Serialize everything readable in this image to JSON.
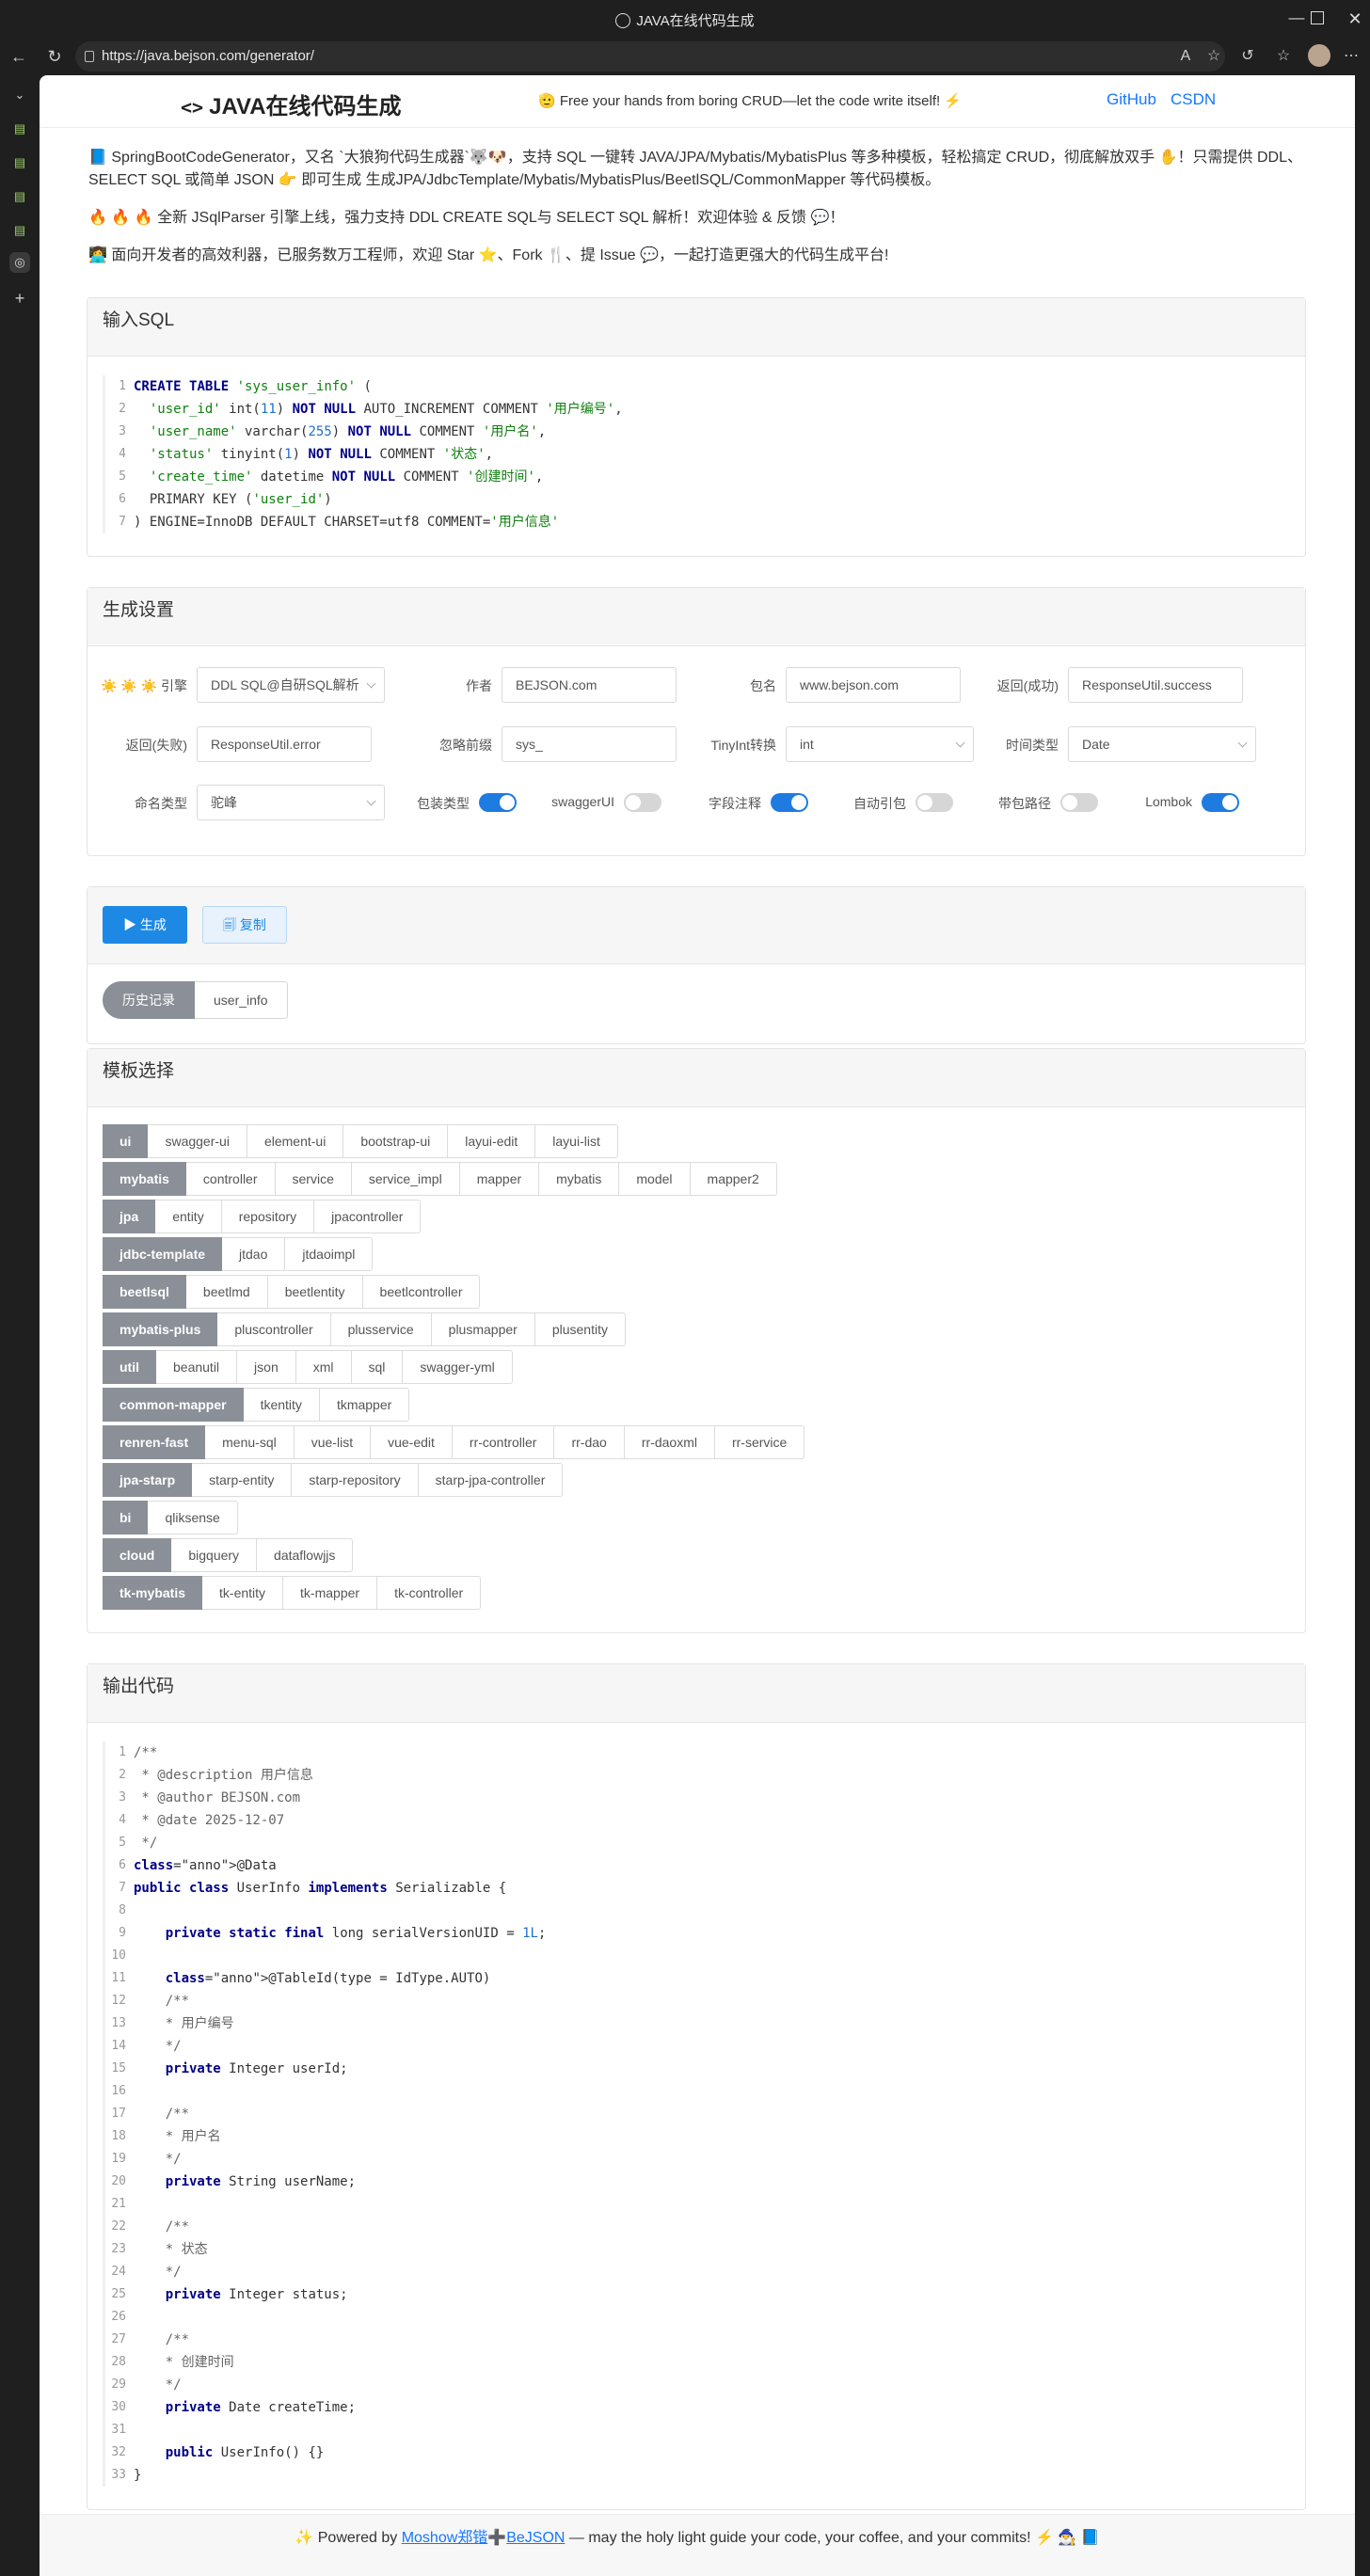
{
  "browser": {
    "window_title": "JAVA在线代码生成",
    "url": "https://java.bejson.com/generator/"
  },
  "header": {
    "logo_code": "<>",
    "logo_text": "JAVA在线代码生成",
    "tagline": "🫡 Free your hands from boring CRUD—let the code write itself! ⚡",
    "links": [
      "GitHub",
      "CSDN"
    ]
  },
  "intro": [
    "📘 SpringBootCodeGenerator，又名 `大狼狗代码生成器`🐺🐶，支持 SQL 一键转 JAVA/JPA/Mybatis/MybatisPlus 等多种模板，轻松搞定 CRUD，彻底解放双手 ✋！只需提供 DDL、SELECT SQL 或简单 JSON 👉 即可生成 生成JPA/JdbcTemplate/Mybatis/MybatisPlus/BeetlSQL/CommonMapper 等代码模板。",
    "🔥 🔥 🔥 全新 JSqlParser 引擎上线，强力支持 DDL CREATE SQL与 SELECT SQL 解析！欢迎体验 & 反馈 💬！",
    "👩‍💻 面向开发者的高效利器，已服务数万工程师，欢迎 Star ⭐、Fork 🍴、提 Issue 💬，一起打造更强大的代码生成平台!"
  ],
  "input_sql": {
    "title": "输入SQL",
    "lines": [
      "CREATE TABLE 'sys_user_info' (",
      "  'user_id' int(11) NOT NULL AUTO_INCREMENT COMMENT '用户编号',",
      "  'user_name' varchar(255) NOT NULL COMMENT '用户名',",
      "  'status' tinyint(1) NOT NULL COMMENT '状态',",
      "  'create_time' datetime NOT NULL COMMENT '创建时间',",
      "  PRIMARY KEY ('user_id')",
      ") ENGINE=InnoDB DEFAULT CHARSET=utf8 COMMENT='用户信息'"
    ]
  },
  "settings": {
    "title": "生成设置",
    "engine_label": "☀️ ☀️ ☀️ 引擎",
    "engine_value": "DDL SQL@自研SQL解析",
    "author_label": "作者",
    "author_value": "BEJSON.com",
    "package_label": "包名",
    "package_value": "www.bejson.com",
    "return_success_label": "返回(成功)",
    "return_success_value": "ResponseUtil.success",
    "return_fail_label": "返回(失败)",
    "return_fail_value": "ResponseUtil.error",
    "ignore_prefix_label": "忽略前缀",
    "ignore_prefix_value": "sys_",
    "tinyint_label": "TinyInt转换",
    "tinyint_value": "int",
    "time_type_label": "时间类型",
    "time_type_value": "Date",
    "naming_label": "命名类型",
    "naming_value": "驼峰",
    "toggles": [
      {
        "label": "包装类型",
        "on": true
      },
      {
        "label": "swaggerUI",
        "on": false
      },
      {
        "label": "字段注释",
        "on": true
      },
      {
        "label": "自动引包",
        "on": false
      },
      {
        "label": "带包路径",
        "on": false
      },
      {
        "label": "Lombok",
        "on": true
      }
    ]
  },
  "actions": {
    "generate_label": "▶ 生成",
    "copy_label": "🗐 复制",
    "history_label": "历史记录",
    "history_items": [
      "user_info"
    ]
  },
  "templates": {
    "title": "模板选择",
    "groups": [
      {
        "name": "ui",
        "items": [
          "swagger-ui",
          "element-ui",
          "bootstrap-ui",
          "layui-edit",
          "layui-list"
        ]
      },
      {
        "name": "mybatis",
        "items": [
          "controller",
          "service",
          "service_impl",
          "mapper",
          "mybatis",
          "model",
          "mapper2"
        ]
      },
      {
        "name": "jpa",
        "items": [
          "entity",
          "repository",
          "jpacontroller"
        ]
      },
      {
        "name": "jdbc-template",
        "items": [
          "jtdao",
          "jtdaoimpl"
        ]
      },
      {
        "name": "beetlsql",
        "items": [
          "beetlmd",
          "beetlentity",
          "beetlcontroller"
        ]
      },
      {
        "name": "mybatis-plus",
        "items": [
          "pluscontroller",
          "plusservice",
          "plusmapper",
          "plusentity"
        ]
      },
      {
        "name": "util",
        "items": [
          "beanutil",
          "json",
          "xml",
          "sql",
          "swagger-yml"
        ]
      },
      {
        "name": "common-mapper",
        "items": [
          "tkentity",
          "tkmapper"
        ]
      },
      {
        "name": "renren-fast",
        "items": [
          "menu-sql",
          "vue-list",
          "vue-edit",
          "rr-controller",
          "rr-dao",
          "rr-daoxml",
          "rr-service"
        ]
      },
      {
        "name": "jpa-starp",
        "items": [
          "starp-entity",
          "starp-repository",
          "starp-jpa-controller"
        ]
      },
      {
        "name": "bi",
        "items": [
          "qliksense"
        ]
      },
      {
        "name": "cloud",
        "items": [
          "bigquery",
          "dataflowjjs"
        ]
      },
      {
        "name": "tk-mybatis",
        "items": [
          "tk-entity",
          "tk-mapper",
          "tk-controller"
        ]
      }
    ]
  },
  "output": {
    "title": "输出代码",
    "lines": [
      "/**",
      " * @description 用户信息",
      " * @author BEJSON.com",
      " * @date 2025-12-07",
      " */",
      "@Data",
      "public class UserInfo implements Serializable {",
      "",
      "    private static final long serialVersionUID = 1L;",
      "",
      "    @TableId(type = IdType.AUTO)",
      "    /**",
      "    * 用户编号",
      "    */",
      "    private Integer userId;",
      "",
      "    /**",
      "    * 用户名",
      "    */",
      "    private String userName;",
      "",
      "    /**",
      "    * 状态",
      "    */",
      "    private Integer status;",
      "",
      "    /**",
      "    * 创建时间",
      "    */",
      "    private Date createTime;",
      "",
      "    public UserInfo() {}",
      "}"
    ]
  },
  "footer": {
    "prefix": "✨ Powered by ",
    "link1": "Moshow郑锴",
    "plus": "➕",
    "link2": "BeJSON",
    "suffix": " — may the holy light guide your code, your coffee, and your commits! ⚡ 🧙‍♂️ 📘"
  },
  "colors": {
    "accent": "#1e88e5",
    "link": "#1677ff",
    "group_tag": "#8a8f98"
  }
}
